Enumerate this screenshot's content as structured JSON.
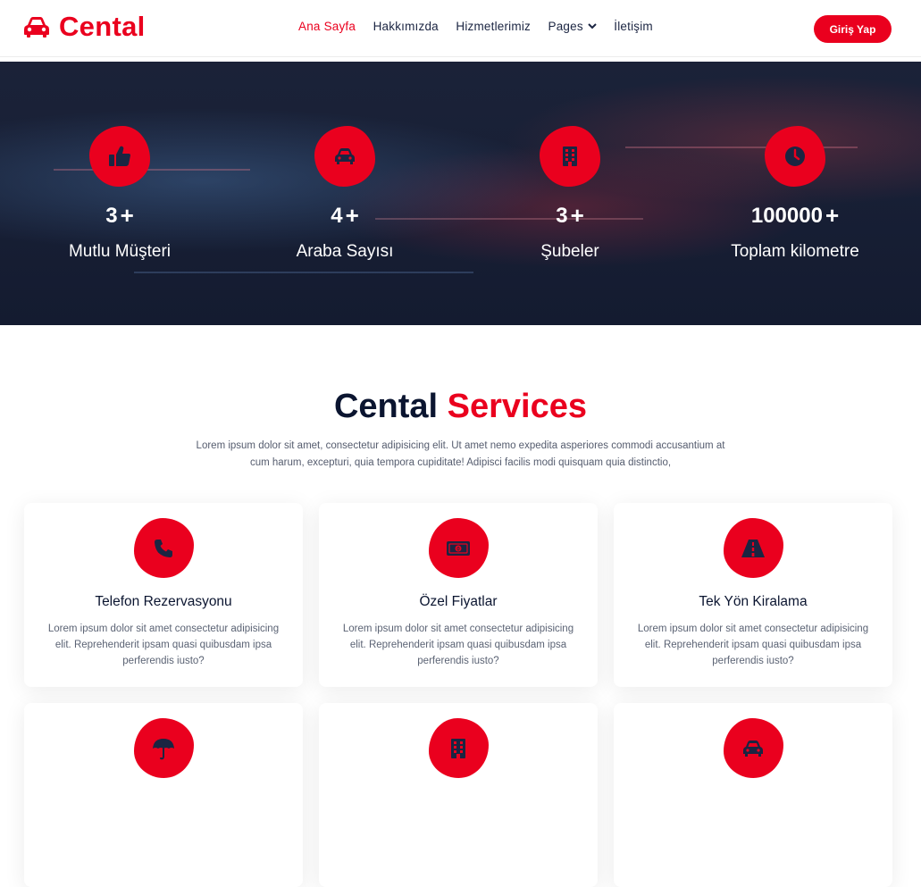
{
  "nav": {
    "brand": "Cental",
    "items": [
      {
        "label": "Ana Sayfa",
        "active": true
      },
      {
        "label": "Hakkımızda"
      },
      {
        "label": "Hizmetlerimiz"
      },
      {
        "label": "Pages",
        "dropdown": true
      },
      {
        "label": "İletişim"
      }
    ],
    "login": "Giriş Yap"
  },
  "stats": [
    {
      "icon": "thumbs-up-icon",
      "number": "3",
      "plus": "+",
      "label": "Mutlu Müşteri"
    },
    {
      "icon": "car-icon",
      "number": "4",
      "plus": "+",
      "label": "Araba Sayısı"
    },
    {
      "icon": "building-icon",
      "number": "3",
      "plus": "+",
      "label": "Şubeler"
    },
    {
      "icon": "clock-icon",
      "number": "100000",
      "plus": "+",
      "label": "Toplam kilometre"
    }
  ],
  "services": {
    "title_main": "Cental",
    "title_accent": "Services",
    "description": "Lorem ipsum dolor sit amet, consectetur adipisicing elit. Ut amet nemo expedita asperiores commodi accusantium at cum harum, excepturi, quia tempora cupiditate! Adipisci facilis modi quisquam quia distinctio,",
    "cards": [
      {
        "icon": "phone-icon",
        "title": "Telefon Rezervasyonu",
        "text": "Lorem ipsum dolor sit amet consectetur adipisicing elit. Reprehenderit ipsam quasi quibusdam ipsa perferendis iusto?"
      },
      {
        "icon": "money-icon",
        "title": "Özel Fiyatlar",
        "text": "Lorem ipsum dolor sit amet consectetur adipisicing elit. Reprehenderit ipsam quasi quibusdam ipsa perferendis iusto?"
      },
      {
        "icon": "road-icon",
        "title": "Tek Yön Kiralama",
        "text": "Lorem ipsum dolor sit amet consectetur adipisicing elit. Reprehenderit ipsam quasi quibusdam ipsa perferendis iusto?"
      },
      {
        "icon": "umbrella-icon"
      },
      {
        "icon": "building-icon"
      },
      {
        "icon": "car-icon"
      }
    ]
  },
  "colors": {
    "accent": "#ea001e",
    "dark": "#0b1530"
  }
}
